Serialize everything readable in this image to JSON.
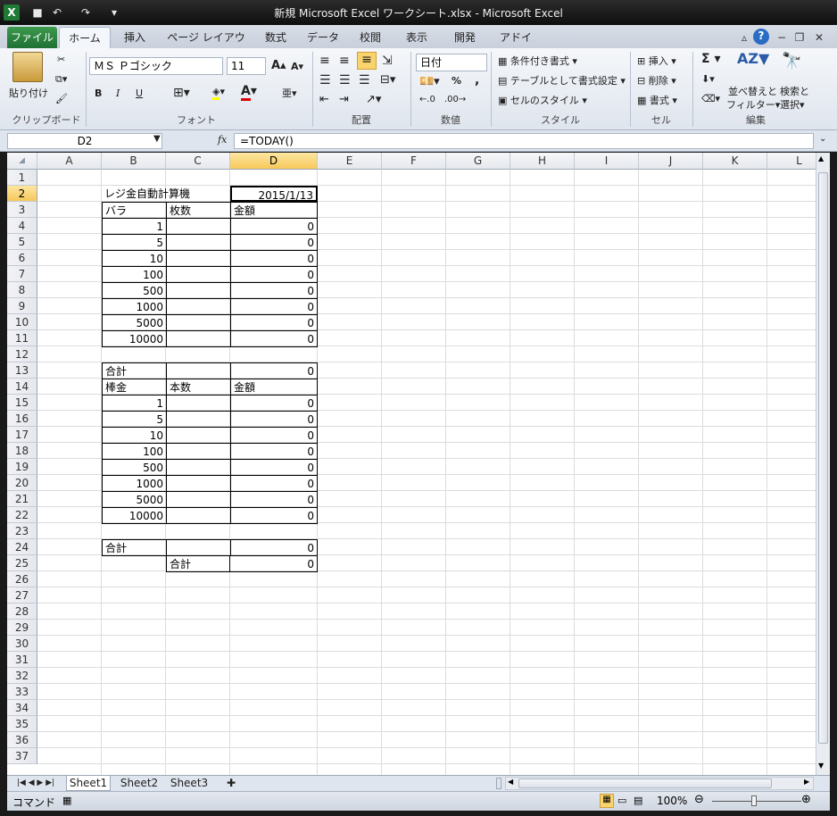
{
  "window": {
    "title": "新規 Microsoft Excel ワークシート.xlsx - Microsoft Excel"
  },
  "ribbon": {
    "tabs": [
      "ファイル",
      "ホーム",
      "挿入",
      "ページ レイアウト",
      "数式",
      "データ",
      "校閲",
      "表示",
      "開発",
      "アドイン"
    ],
    "clipboard": {
      "paste": "貼り付け",
      "label": "クリップボード"
    },
    "font": {
      "name": "ＭＳ Ｐゴシック",
      "size": "11",
      "label": "フォント",
      "bold": "B",
      "italic": "I",
      "underline": "U"
    },
    "alignment": {
      "label": "配置"
    },
    "number": {
      "format": "日付",
      "label": "数値",
      "percent": "%",
      "comma": ","
    },
    "styles": {
      "conditional": "条件付き書式",
      "table": "テーブルとして書式設定",
      "cell_styles": "セルのスタイル",
      "label": "スタイル"
    },
    "cells": {
      "insert": "挿入",
      "delete": "削除",
      "format": "書式",
      "label": "セル"
    },
    "editing": {
      "sum": "Σ",
      "sort1": "並べ替えと",
      "sort2": "フィルター",
      "find1": "検索と",
      "find2": "選択",
      "label": "編集"
    }
  },
  "formula_bar": {
    "name_box": "D2",
    "fx": "fx",
    "formula": "=TODAY()"
  },
  "columns": [
    "A",
    "B",
    "C",
    "D",
    "E",
    "F",
    "G",
    "H",
    "I",
    "J",
    "K",
    "L"
  ],
  "rows": [
    "1",
    "2",
    "3",
    "4",
    "5",
    "6",
    "7",
    "8",
    "9",
    "10",
    "11",
    "12",
    "13",
    "14",
    "15",
    "16",
    "17",
    "18",
    "19",
    "20",
    "21",
    "22",
    "23",
    "24",
    "25",
    "26",
    "27",
    "28",
    "29",
    "30",
    "31",
    "32",
    "33",
    "34",
    "35",
    "36",
    "37"
  ],
  "cells": {
    "b2": "レジ金自動計算機",
    "d2": "2015/1/13",
    "b3": "バラ",
    "c3": "枚数",
    "d3": "金額",
    "bara": [
      "1",
      "5",
      "10",
      "100",
      "500",
      "1000",
      "5000",
      "10000"
    ],
    "bara_amount": [
      "0",
      "0",
      "0",
      "0",
      "0",
      "0",
      "0",
      "0"
    ],
    "b12": "合計",
    "d12": "0",
    "b14": "棒金",
    "c14": "本数",
    "d14": "金額",
    "bou": [
      "1",
      "5",
      "10",
      "100",
      "500",
      "1000",
      "5000",
      "10000"
    ],
    "bou_amount": [
      "0",
      "0",
      "0",
      "0",
      "0",
      "0",
      "0",
      "0"
    ],
    "b23": "合計",
    "d23": "0",
    "c25": "合計",
    "d25": "0"
  },
  "sheets": [
    "Sheet1",
    "Sheet2",
    "Sheet3"
  ],
  "status": {
    "mode": "コマンド",
    "zoom": "100%"
  }
}
